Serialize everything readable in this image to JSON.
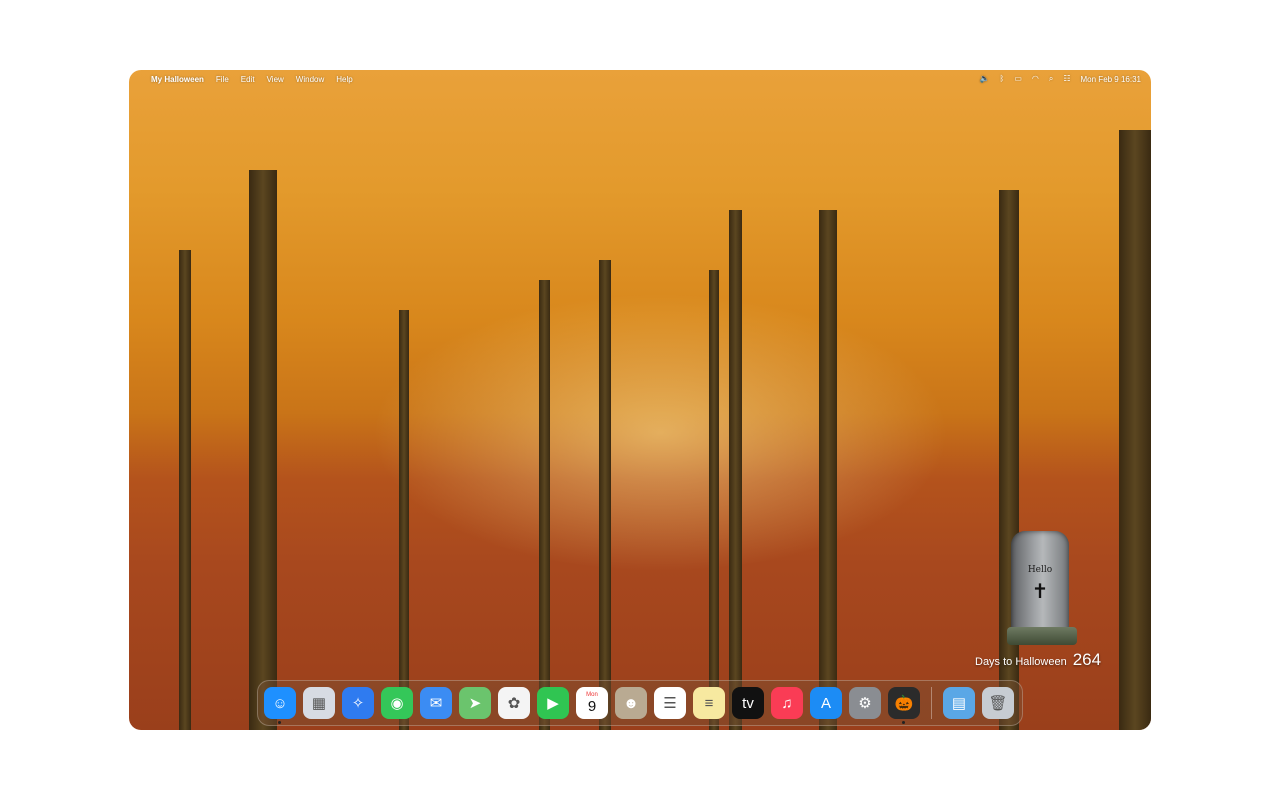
{
  "menubar": {
    "apple_icon": "apple-logo",
    "app_name": "My Halloween",
    "menus": [
      "File",
      "Edit",
      "View",
      "Window",
      "Help"
    ],
    "status_icons": [
      "volume-icon",
      "bluetooth-icon",
      "battery-icon",
      "wifi-icon",
      "search-icon",
      "control-center-icon"
    ],
    "datetime": "Mon Feb 9  16:31"
  },
  "widget": {
    "tombstone_text": "Hello",
    "countdown_label": "Days to Halloween",
    "countdown_value": "264"
  },
  "dock": {
    "calendar_month": "Mon",
    "calendar_day": "9",
    "apps": [
      {
        "name": "Finder",
        "icon": "finder-icon",
        "color": "#1e90ff",
        "glyph": "☺",
        "running": true
      },
      {
        "name": "Launchpad",
        "icon": "launchpad-icon",
        "color": "#d7dbe3",
        "glyph": "▦",
        "running": false
      },
      {
        "name": "Safari",
        "icon": "safari-icon",
        "color": "#2f7bf0",
        "glyph": "✧",
        "running": false
      },
      {
        "name": "Messages",
        "icon": "messages-icon",
        "color": "#34c759",
        "glyph": "◉",
        "running": false
      },
      {
        "name": "Mail",
        "icon": "mail-icon",
        "color": "#3b8cf3",
        "glyph": "✉",
        "running": false
      },
      {
        "name": "Maps",
        "icon": "maps-icon",
        "color": "#6bc46d",
        "glyph": "➤",
        "running": false
      },
      {
        "name": "Photos",
        "icon": "photos-icon",
        "color": "#f4f4f4",
        "glyph": "✿",
        "running": false
      },
      {
        "name": "FaceTime",
        "icon": "facetime-icon",
        "color": "#30c552",
        "glyph": "▶",
        "running": false
      },
      {
        "name": "Calendar",
        "icon": "calendar-icon",
        "color": "#ffffff",
        "glyph": "",
        "running": false
      },
      {
        "name": "Contacts",
        "icon": "contacts-icon",
        "color": "#b9aa92",
        "glyph": "☻",
        "running": false
      },
      {
        "name": "Reminders",
        "icon": "reminders-icon",
        "color": "#ffffff",
        "glyph": "☰",
        "running": false
      },
      {
        "name": "Notes",
        "icon": "notes-icon",
        "color": "#f7e9a0",
        "glyph": "≡",
        "running": false
      },
      {
        "name": "TV",
        "icon": "tv-icon",
        "color": "#111111",
        "glyph": "tv",
        "running": false
      },
      {
        "name": "Music",
        "icon": "music-icon",
        "color": "#fa3c55",
        "glyph": "♫",
        "running": false
      },
      {
        "name": "App Store",
        "icon": "app-store-icon",
        "color": "#1c8cf5",
        "glyph": "A",
        "running": false
      },
      {
        "name": "System Settings",
        "icon": "settings-icon",
        "color": "#8a8d92",
        "glyph": "⚙",
        "running": false
      },
      {
        "name": "My Halloween",
        "icon": "pumpkin-icon",
        "color": "#2b2b2b",
        "glyph": "🎃",
        "running": true
      }
    ],
    "extras": [
      {
        "name": "Downloads",
        "icon": "folder-icon",
        "color": "#5aa7e6",
        "glyph": "▤"
      },
      {
        "name": "Trash",
        "icon": "trash-icon",
        "color": "#c7ccd2",
        "glyph": "🗑"
      }
    ]
  }
}
